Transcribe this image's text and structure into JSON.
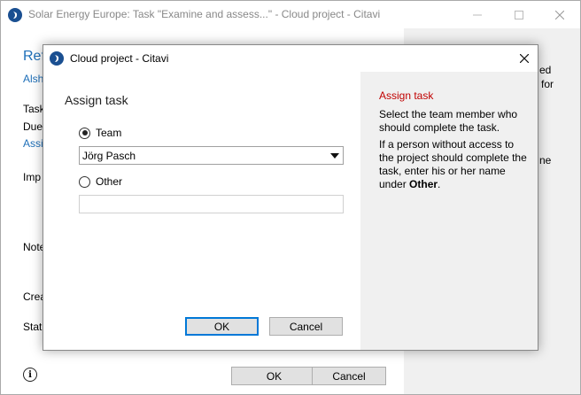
{
  "outer_window": {
    "title": "Solar Energy Europe: Task \"Examine and assess...\" - Cloud project - Citavi",
    "heading": "Ref",
    "link": "Alsh",
    "labels": {
      "task": "Task",
      "due": "Due",
      "assign": "Assi",
      "importance": "Imp",
      "notes": "Note",
      "created": "Crea",
      "status": "Statu"
    },
    "right_panel_fragments": {
      "line1": "ed",
      "line2": "for",
      "line3": "ne"
    },
    "ok_label": "OK",
    "cancel_label": "Cancel"
  },
  "dialog": {
    "title": "Cloud project - Citavi",
    "section_title": "Assign task",
    "team_label": "Team",
    "team_selected": true,
    "team_member": "Jörg Pasch",
    "other_label": "Other",
    "other_value": "",
    "ok_label": "OK",
    "cancel_label": "Cancel"
  },
  "help": {
    "title": "Assign task",
    "paragraph1": "Select the team member who should complete the task.",
    "paragraph2_prefix": "If a person without access to the project should complete the task, enter his or her name under ",
    "paragraph2_bold": "Other",
    "paragraph2_suffix": "."
  },
  "colors": {
    "accent": "#1e6fb8",
    "help_title": "#c00000",
    "help_panel_bg": "#f0f0f0"
  }
}
